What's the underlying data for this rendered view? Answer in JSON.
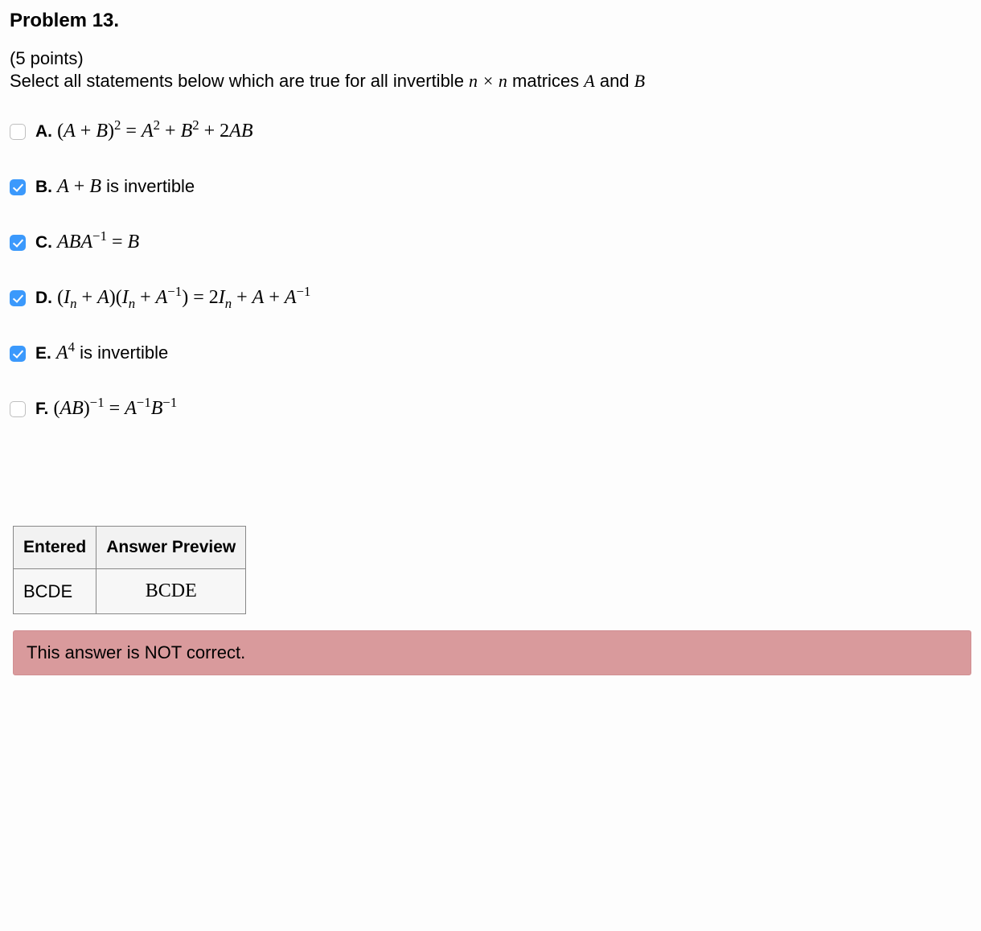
{
  "title": "Problem 13.",
  "points_text": "(5 points)",
  "prompt_pre": "Select all statements below which are true for all invertible ",
  "prompt_dims": "n × n",
  "prompt_mid": " matrices ",
  "prompt_a": "A",
  "prompt_and": " and ",
  "prompt_b": "B",
  "options": {
    "a": {
      "label": "A.",
      "checked": false
    },
    "b": {
      "label": "B.",
      "checked": true,
      "suffix": " is invertible"
    },
    "c": {
      "label": "C.",
      "checked": true
    },
    "d": {
      "label": "D.",
      "checked": true
    },
    "e": {
      "label": "E.",
      "checked": true,
      "suffix": " is invertible"
    },
    "f": {
      "label": "F.",
      "checked": false
    }
  },
  "table": {
    "header_entered": "Entered",
    "header_preview": "Answer Preview",
    "entered_value": "BCDE",
    "preview_value": "BCDE"
  },
  "feedback": "This answer is NOT correct."
}
